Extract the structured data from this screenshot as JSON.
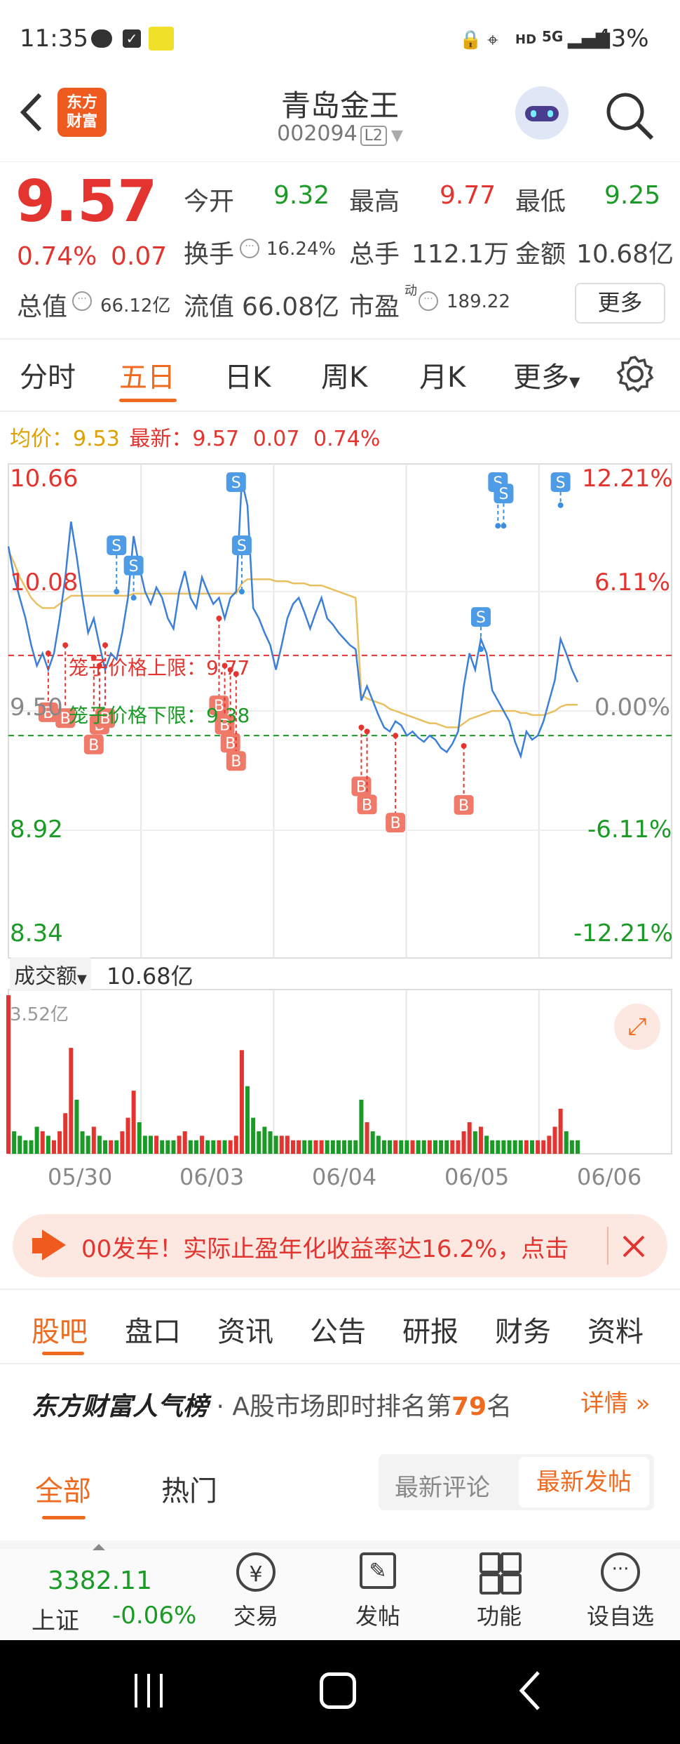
{
  "status_bar": {
    "time": "11:35",
    "icons": [
      "chat-icon",
      "check-icon",
      "app-icon"
    ],
    "right_icons": [
      "lock-icon",
      "location-icon",
      "hd-icon",
      "5g-icon",
      "signal-icon"
    ],
    "battery": "43%"
  },
  "header": {
    "title": "青岛金王",
    "code": "002094",
    "level": "L2",
    "logo_line1": "东方",
    "logo_line2": "财富"
  },
  "quote": {
    "price": "9.57",
    "change_pct": "0.74%",
    "change": "0.07",
    "open_label": "今开",
    "open": "9.32",
    "high_label": "最高",
    "high": "9.77",
    "low_label": "最低",
    "low": "9.25",
    "turnover_label": "换手",
    "turnover": "16.24%",
    "volume_label": "总手",
    "volume": "112.1万",
    "amount_label": "金额",
    "amount": "10.68亿",
    "mcap_label": "总值",
    "mcap": "66.12亿",
    "float_label": "流值",
    "float": "66.08亿",
    "pe_label": "市盈",
    "pe_sup": "动",
    "pe": "189.22",
    "more": "更多"
  },
  "tabs": [
    "分时",
    "五日",
    "日K",
    "周K",
    "月K",
    "更多"
  ],
  "active_tab": "五日",
  "chart_info": {
    "avg_label": "均价：",
    "avg": "9.53",
    "latest_label": "最新：",
    "latest": "9.57",
    "chg": "0.07",
    "chg_pct": "0.74%"
  },
  "chart_data": {
    "type": "line",
    "y_ticks_left": [
      "10.66",
      "10.08",
      "9.50",
      "8.92",
      "8.34"
    ],
    "y_ticks_right": [
      "12.21%",
      "6.11%",
      "0.00%",
      "-6.11%",
      "-12.21%"
    ],
    "ylim": [
      8.34,
      10.66
    ],
    "upper_cage_label": "笼子价格上限：9.77",
    "lower_cage_label": "笼子价格下限：9.38",
    "x_labels": [
      "05/30",
      "06/03",
      "06/04",
      "06/05",
      "06/06"
    ],
    "signal_labels": {
      "buy": "B",
      "sell": "S"
    },
    "series": [
      {
        "values": [
          10.3,
          10.15,
          10.05,
          9.95,
          9.82,
          9.72,
          9.78,
          9.7,
          9.78,
          9.95,
          10.15,
          10.42,
          10.25,
          10.05,
          9.88,
          9.95,
          9.82,
          9.7,
          9.78,
          9.75,
          9.88,
          10.05,
          10.35,
          10.2,
          10.08,
          10.02,
          10.1,
          10.05,
          9.95,
          9.9,
          10.08,
          10.18,
          10.05,
          10.0,
          10.15,
          10.08,
          10.02,
          10.05,
          9.95,
          10.05,
          10.08,
          10.62,
          10.5,
          10.0,
          9.95,
          9.88,
          9.82,
          9.7,
          9.82,
          9.95,
          10.02,
          10.05,
          9.98,
          9.9,
          9.98,
          10.05,
          9.95,
          9.92,
          9.88,
          9.85,
          9.82,
          9.8,
          9.55,
          9.62,
          9.55,
          9.48,
          9.42,
          9.4,
          9.45,
          9.43,
          9.38,
          9.4,
          9.37,
          9.35,
          9.38,
          9.36,
          9.32,
          9.3,
          9.34,
          9.4,
          9.62,
          9.78,
          9.7,
          9.85,
          9.78,
          9.6,
          9.55,
          9.5,
          9.45,
          9.35,
          9.28,
          9.4,
          9.36,
          9.38,
          9.45,
          9.55,
          9.65,
          9.85,
          9.78,
          9.7,
          9.64
        ]
      },
      {
        "name": "均价",
        "values": [
          10.28,
          10.22,
          10.15,
          10.1,
          10.05,
          10.02,
          10.0,
          10.0,
          10.0,
          10.02,
          10.04,
          10.06,
          10.06,
          10.06,
          10.06,
          10.06,
          10.06,
          10.06,
          10.06,
          10.06,
          10.06,
          10.06,
          10.07,
          10.07,
          10.07,
          10.07,
          10.07,
          10.07,
          10.07,
          10.07,
          10.07,
          10.07,
          10.07,
          10.07,
          10.07,
          10.07,
          10.07,
          10.07,
          10.07,
          10.07,
          10.07,
          10.12,
          10.14,
          10.14,
          10.14,
          10.14,
          10.14,
          10.13,
          10.13,
          10.13,
          10.12,
          10.12,
          10.12,
          10.11,
          10.11,
          10.11,
          10.1,
          10.09,
          10.08,
          10.07,
          10.06,
          10.05,
          9.58,
          9.56,
          9.55,
          9.54,
          9.53,
          9.51,
          9.5,
          9.49,
          9.48,
          9.47,
          9.46,
          9.45,
          9.44,
          9.44,
          9.43,
          9.42,
          9.42,
          9.42,
          9.44,
          9.46,
          9.47,
          9.48,
          9.49,
          9.5,
          9.5,
          9.5,
          9.5,
          9.5,
          9.49,
          9.49,
          9.48,
          9.48,
          9.48,
          9.49,
          9.5,
          9.52,
          9.53,
          9.53,
          9.53
        ]
      }
    ],
    "buy_signals": [
      9.78,
      9.82,
      9.76,
      9.72,
      9.82,
      9.95,
      9.72,
      9.7,
      9.68,
      9.42,
      9.4,
      9.38,
      9.33
    ],
    "sell_signals": [
      10.05,
      10.08,
      10.62,
      10.08,
      9.8,
      10.4,
      10.4,
      10.5
    ],
    "volume_label": "成交额",
    "volume_total": "10.68亿",
    "volume_max": "3.52亿",
    "volume_values": [
      3.52,
      0.5,
      0.4,
      0.3,
      0.3,
      0.6,
      0.5,
      0.4,
      0.3,
      0.5,
      0.9,
      2.35,
      1.2,
      0.5,
      0.4,
      0.6,
      0.4,
      0.3,
      0.3,
      0.3,
      0.5,
      0.8,
      1.4,
      0.7,
      0.4,
      0.4,
      0.4,
      0.3,
      0.3,
      0.3,
      0.4,
      0.5,
      0.3,
      0.3,
      0.4,
      0.3,
      0.3,
      0.3,
      0.3,
      0.3,
      0.4,
      2.3,
      1.5,
      0.8,
      0.5,
      0.6,
      0.5,
      0.4,
      0.4,
      0.4,
      0.3,
      0.3,
      0.3,
      0.3,
      0.3,
      0.3,
      0.3,
      0.3,
      0.3,
      0.3,
      0.3,
      0.3,
      1.2,
      0.7,
      0.5,
      0.4,
      0.3,
      0.3,
      0.3,
      0.3,
      0.3,
      0.3,
      0.3,
      0.3,
      0.3,
      0.3,
      0.3,
      0.3,
      0.3,
      0.3,
      0.5,
      0.7,
      0.5,
      0.6,
      0.4,
      0.3,
      0.3,
      0.3,
      0.3,
      0.3,
      0.3,
      0.3,
      0.3,
      0.3,
      0.3,
      0.4,
      0.6,
      1.0,
      0.5,
      0.3,
      0.3
    ],
    "volume_colors": {
      "up": "#e3342f",
      "down": "#1a9b26"
    }
  },
  "banner": {
    "text": "00发车！实际止盈年化收益率达16.2%，点击",
    "icon": "megaphone-icon"
  },
  "section_tabs": [
    "股吧",
    "盘口",
    "资讯",
    "公告",
    "研报",
    "财务",
    "资料"
  ],
  "active_section": "股吧",
  "ranking": {
    "brand": "东方财富人气榜",
    "text": "· A股市场即时排名第",
    "rank": "79",
    "suffix": "名",
    "link": "详情"
  },
  "sub_tabs": [
    "全部",
    "热门"
  ],
  "sort_options": {
    "option1": "最新评论",
    "option2": "最新发帖"
  },
  "bottom_nav": {
    "index_value": "3382.11",
    "index_name": "上证",
    "index_change": "-0.06%",
    "items": [
      {
        "label": "交易",
        "icon": "yen-icon"
      },
      {
        "label": "发帖",
        "icon": "edit-icon"
      },
      {
        "label": "功能",
        "icon": "grid-icon"
      },
      {
        "label": "设自选",
        "icon": "more-icon"
      }
    ]
  },
  "colors": {
    "up": "#e3342f",
    "down": "#1a9b26",
    "accent": "#ef6b1f",
    "price_line": "#3b7fd9",
    "avg_line": "#e8c060"
  }
}
